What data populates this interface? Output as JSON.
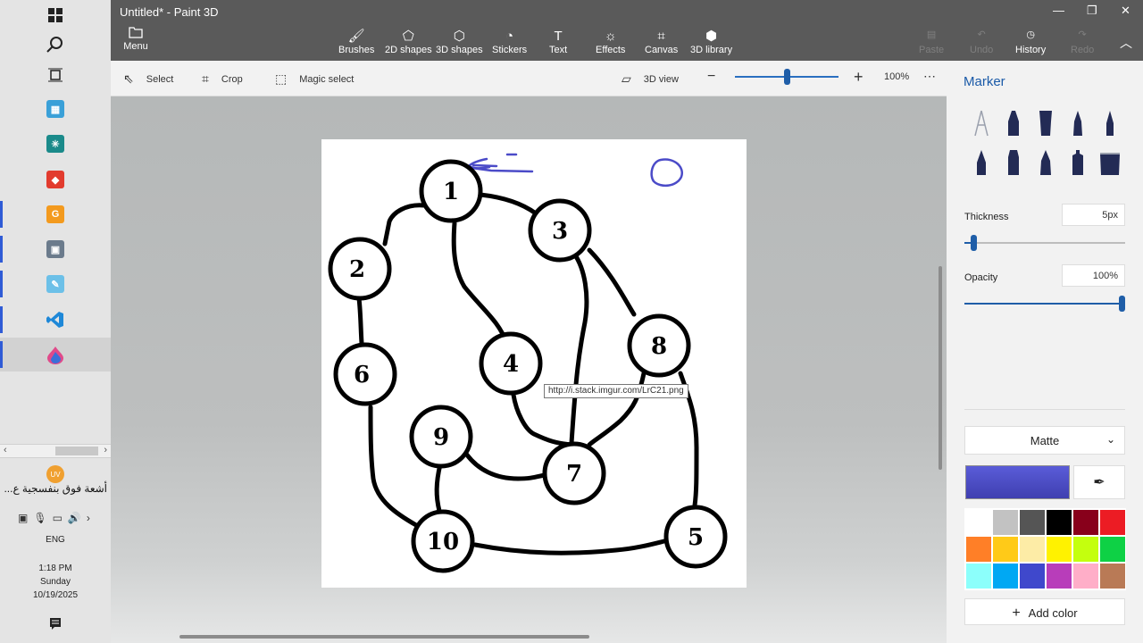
{
  "window": {
    "title": "Untitled* - Paint 3D"
  },
  "ribbon": {
    "menu_label": "Menu",
    "tools": [
      "Brushes",
      "2D shapes",
      "3D shapes",
      "Stickers",
      "Text",
      "Effects",
      "Canvas",
      "3D library"
    ],
    "right": [
      "Paste",
      "Undo",
      "History",
      "Redo"
    ]
  },
  "toolbar": {
    "select_label": "Select",
    "crop_label": "Crop",
    "magic_select_label": "Magic select",
    "view3d_label": "3D view",
    "zoom_value": "100%",
    "zoom_level": 0.5
  },
  "panel": {
    "title": "Marker",
    "thickness_label": "Thickness",
    "thickness_value": "5px",
    "opacity_label": "Opacity",
    "opacity_value": "100%",
    "finish_value": "Matte",
    "add_color_label": "Add color",
    "current_color": "#4a4bc8",
    "palette": [
      "#ffffff",
      "#c2c2c2",
      "#555555",
      "#000000",
      "#88001b",
      "#ec1c24",
      "#ff7f27",
      "#ffca18",
      "#fdeca6",
      "#fff200",
      "#c4ff0e",
      "#0ed145",
      "#8cfffb",
      "#00a8f3",
      "#3f48cc",
      "#b83dba",
      "#ffaec8",
      "#b97a56"
    ]
  },
  "canvas": {
    "nodes": [
      "1",
      "2",
      "3",
      "4",
      "5",
      "6",
      "7",
      "8",
      "9",
      "10"
    ],
    "tooltip": "http://i.stack.imgur.com/LrC21.png"
  },
  "taskbar": {
    "news_avatar": "UV",
    "news_text": "أشعة فوق بنفسجية ع...",
    "language": "ENG",
    "time": "1:18 PM",
    "day": "Sunday",
    "date": "10/19/2025"
  }
}
